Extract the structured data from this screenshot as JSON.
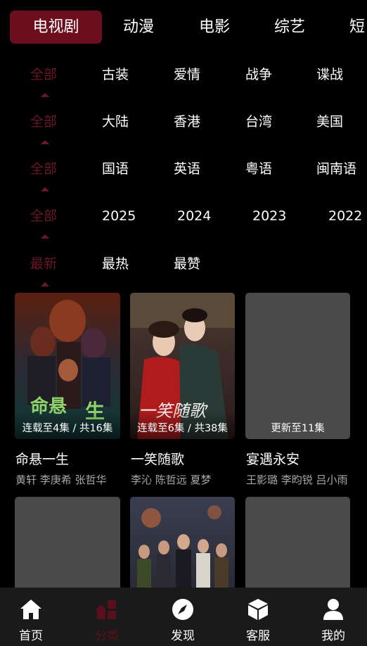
{
  "top_tabs": [
    {
      "label": "电视剧",
      "active": true
    },
    {
      "label": "动漫",
      "active": false
    },
    {
      "label": "电影",
      "active": false
    },
    {
      "label": "综艺",
      "active": false
    },
    {
      "label": "短",
      "active": false
    }
  ],
  "filters": [
    {
      "options": [
        "全部",
        "古装",
        "爱情",
        "战争",
        "谍战"
      ],
      "selected": 0
    },
    {
      "options": [
        "全部",
        "大陆",
        "香港",
        "台湾",
        "美国"
      ],
      "selected": 0
    },
    {
      "options": [
        "全部",
        "国语",
        "英语",
        "粤语",
        "闽南语"
      ],
      "selected": 0
    },
    {
      "options": [
        "全部",
        "2025",
        "2024",
        "2023",
        "2022"
      ],
      "selected": 0
    },
    {
      "options": [
        "最新",
        "最热",
        "最赞"
      ],
      "selected": 0
    }
  ],
  "cards": [
    {
      "title": "命悬一生",
      "cast": "黄轩  李庚希  张哲华",
      "episode": "连载至4集 / 共16集",
      "poster": "dark-thriller"
    },
    {
      "title": "一笑随歌",
      "cast": "李沁  陈哲远  夏梦",
      "episode": "连载至6集 / 共38集",
      "poster": "costume-romance"
    },
    {
      "title": "宴遇永安",
      "cast": "王影璐  李昀锐  吕小雨",
      "episode": "更新至11集",
      "poster": "placeholder"
    },
    {
      "title": "",
      "cast": "",
      "episode": "",
      "poster": "placeholder"
    },
    {
      "title": "",
      "cast": "",
      "episode": "",
      "poster": "war-drama"
    },
    {
      "title": "",
      "cast": "",
      "episode": "",
      "poster": "placeholder"
    }
  ],
  "bottom_nav": [
    {
      "label": "首页",
      "icon": "home-icon",
      "active": false
    },
    {
      "label": "分类",
      "icon": "category-icon",
      "active": true
    },
    {
      "label": "发现",
      "icon": "compass-icon",
      "active": false
    },
    {
      "label": "客服",
      "icon": "cube-icon",
      "active": false
    },
    {
      "label": "我的",
      "icon": "user-icon",
      "active": false
    }
  ],
  "colors": {
    "accent": "#6d0e1e",
    "selected_text": "#6a1726",
    "background": "#000000",
    "nav_background": "#1a1a1a",
    "placeholder": "#4a4a4a",
    "muted_text": "#a8a8a8"
  }
}
